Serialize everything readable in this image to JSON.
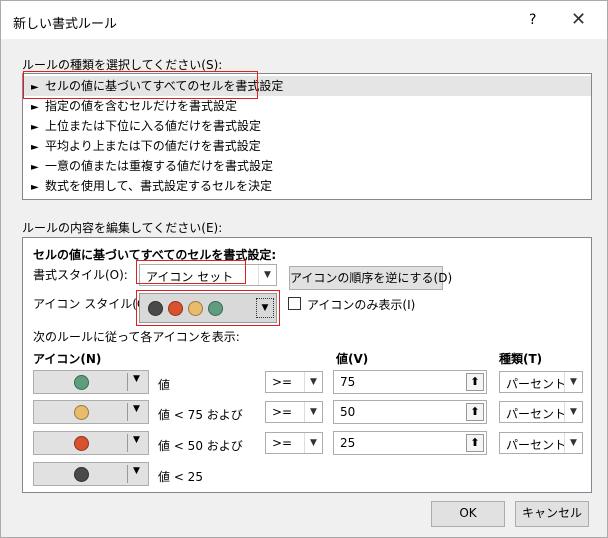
{
  "title": "新しい書式ルール",
  "help": "?",
  "close": "✕",
  "rule_type_label": "ルールの種類を選択してください(S):",
  "rule_types": [
    "セルの値に基づいてすべてのセルを書式設定",
    "指定の値を含むセルだけを書式設定",
    "上位または下位に入る値だけを書式設定",
    "平均より上または下の値だけを書式設定",
    "一意の値または重複する値だけを書式設定",
    "数式を使用して、書式設定するセルを決定"
  ],
  "rule_arrow": "►",
  "edit_label": "ルールの内容を編集してください(E):",
  "edit_heading": "セルの値に基づいてすべてのセルを書式設定:",
  "format_style_label": "書式スタイル(O):",
  "format_style_value": "アイコン セット",
  "reverse_button": "アイコンの順序を逆にする(D)",
  "icon_style_label": "アイコン スタイル(C):",
  "icon_only_label": "アイコンのみ表示(I)",
  "rules_caption": "次のルールに従って各アイコンを表示:",
  "col_icon": "アイコン(N)",
  "col_value": "値(V)",
  "col_type": "種類(T)",
  "colors": {
    "green": "#5e9e7f",
    "yellow": "#e8bc6a",
    "red": "#d9522e",
    "black": "#4a4a4a",
    "accent": "#e02020"
  },
  "rows": [
    {
      "desc": "値",
      "op": ">=",
      "value": "75",
      "type": "パーセント"
    },
    {
      "desc": "値 < 75 および",
      "op": ">=",
      "value": "50",
      "type": "パーセント"
    },
    {
      "desc": "値 < 50 および",
      "op": ">=",
      "value": "25",
      "type": "パーセント"
    },
    {
      "desc": "値 < 25"
    }
  ],
  "ok": "OK",
  "cancel": "キャンセル"
}
